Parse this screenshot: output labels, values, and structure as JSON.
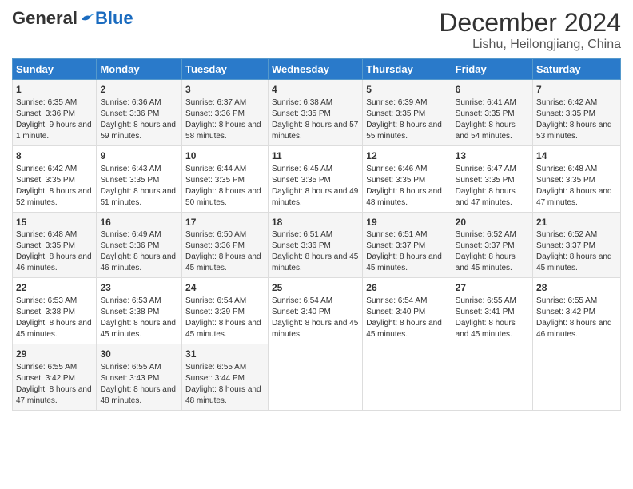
{
  "header": {
    "logo_general": "General",
    "logo_blue": "Blue",
    "month_title": "December 2024",
    "location": "Lishu, Heilongjiang, China"
  },
  "days_of_week": [
    "Sunday",
    "Monday",
    "Tuesday",
    "Wednesday",
    "Thursday",
    "Friday",
    "Saturday"
  ],
  "weeks": [
    [
      {
        "day": "1",
        "sunrise": "Sunrise: 6:35 AM",
        "sunset": "Sunset: 3:36 PM",
        "daylight": "Daylight: 9 hours and 1 minute."
      },
      {
        "day": "2",
        "sunrise": "Sunrise: 6:36 AM",
        "sunset": "Sunset: 3:36 PM",
        "daylight": "Daylight: 8 hours and 59 minutes."
      },
      {
        "day": "3",
        "sunrise": "Sunrise: 6:37 AM",
        "sunset": "Sunset: 3:36 PM",
        "daylight": "Daylight: 8 hours and 58 minutes."
      },
      {
        "day": "4",
        "sunrise": "Sunrise: 6:38 AM",
        "sunset": "Sunset: 3:35 PM",
        "daylight": "Daylight: 8 hours and 57 minutes."
      },
      {
        "day": "5",
        "sunrise": "Sunrise: 6:39 AM",
        "sunset": "Sunset: 3:35 PM",
        "daylight": "Daylight: 8 hours and 55 minutes."
      },
      {
        "day": "6",
        "sunrise": "Sunrise: 6:41 AM",
        "sunset": "Sunset: 3:35 PM",
        "daylight": "Daylight: 8 hours and 54 minutes."
      },
      {
        "day": "7",
        "sunrise": "Sunrise: 6:42 AM",
        "sunset": "Sunset: 3:35 PM",
        "daylight": "Daylight: 8 hours and 53 minutes."
      }
    ],
    [
      {
        "day": "8",
        "sunrise": "Sunrise: 6:42 AM",
        "sunset": "Sunset: 3:35 PM",
        "daylight": "Daylight: 8 hours and 52 minutes."
      },
      {
        "day": "9",
        "sunrise": "Sunrise: 6:43 AM",
        "sunset": "Sunset: 3:35 PM",
        "daylight": "Daylight: 8 hours and 51 minutes."
      },
      {
        "day": "10",
        "sunrise": "Sunrise: 6:44 AM",
        "sunset": "Sunset: 3:35 PM",
        "daylight": "Daylight: 8 hours and 50 minutes."
      },
      {
        "day": "11",
        "sunrise": "Sunrise: 6:45 AM",
        "sunset": "Sunset: 3:35 PM",
        "daylight": "Daylight: 8 hours and 49 minutes."
      },
      {
        "day": "12",
        "sunrise": "Sunrise: 6:46 AM",
        "sunset": "Sunset: 3:35 PM",
        "daylight": "Daylight: 8 hours and 48 minutes."
      },
      {
        "day": "13",
        "sunrise": "Sunrise: 6:47 AM",
        "sunset": "Sunset: 3:35 PM",
        "daylight": "Daylight: 8 hours and 47 minutes."
      },
      {
        "day": "14",
        "sunrise": "Sunrise: 6:48 AM",
        "sunset": "Sunset: 3:35 PM",
        "daylight": "Daylight: 8 hours and 47 minutes."
      }
    ],
    [
      {
        "day": "15",
        "sunrise": "Sunrise: 6:48 AM",
        "sunset": "Sunset: 3:35 PM",
        "daylight": "Daylight: 8 hours and 46 minutes."
      },
      {
        "day": "16",
        "sunrise": "Sunrise: 6:49 AM",
        "sunset": "Sunset: 3:36 PM",
        "daylight": "Daylight: 8 hours and 46 minutes."
      },
      {
        "day": "17",
        "sunrise": "Sunrise: 6:50 AM",
        "sunset": "Sunset: 3:36 PM",
        "daylight": "Daylight: 8 hours and 45 minutes."
      },
      {
        "day": "18",
        "sunrise": "Sunrise: 6:51 AM",
        "sunset": "Sunset: 3:36 PM",
        "daylight": "Daylight: 8 hours and 45 minutes."
      },
      {
        "day": "19",
        "sunrise": "Sunrise: 6:51 AM",
        "sunset": "Sunset: 3:37 PM",
        "daylight": "Daylight: 8 hours and 45 minutes."
      },
      {
        "day": "20",
        "sunrise": "Sunrise: 6:52 AM",
        "sunset": "Sunset: 3:37 PM",
        "daylight": "Daylight: 8 hours and 45 minutes."
      },
      {
        "day": "21",
        "sunrise": "Sunrise: 6:52 AM",
        "sunset": "Sunset: 3:37 PM",
        "daylight": "Daylight: 8 hours and 45 minutes."
      }
    ],
    [
      {
        "day": "22",
        "sunrise": "Sunrise: 6:53 AM",
        "sunset": "Sunset: 3:38 PM",
        "daylight": "Daylight: 8 hours and 45 minutes."
      },
      {
        "day": "23",
        "sunrise": "Sunrise: 6:53 AM",
        "sunset": "Sunset: 3:38 PM",
        "daylight": "Daylight: 8 hours and 45 minutes."
      },
      {
        "day": "24",
        "sunrise": "Sunrise: 6:54 AM",
        "sunset": "Sunset: 3:39 PM",
        "daylight": "Daylight: 8 hours and 45 minutes."
      },
      {
        "day": "25",
        "sunrise": "Sunrise: 6:54 AM",
        "sunset": "Sunset: 3:40 PM",
        "daylight": "Daylight: 8 hours and 45 minutes."
      },
      {
        "day": "26",
        "sunrise": "Sunrise: 6:54 AM",
        "sunset": "Sunset: 3:40 PM",
        "daylight": "Daylight: 8 hours and 45 minutes."
      },
      {
        "day": "27",
        "sunrise": "Sunrise: 6:55 AM",
        "sunset": "Sunset: 3:41 PM",
        "daylight": "Daylight: 8 hours and 45 minutes."
      },
      {
        "day": "28",
        "sunrise": "Sunrise: 6:55 AM",
        "sunset": "Sunset: 3:42 PM",
        "daylight": "Daylight: 8 hours and 46 minutes."
      }
    ],
    [
      {
        "day": "29",
        "sunrise": "Sunrise: 6:55 AM",
        "sunset": "Sunset: 3:42 PM",
        "daylight": "Daylight: 8 hours and 47 minutes."
      },
      {
        "day": "30",
        "sunrise": "Sunrise: 6:55 AM",
        "sunset": "Sunset: 3:43 PM",
        "daylight": "Daylight: 8 hours and 48 minutes."
      },
      {
        "day": "31",
        "sunrise": "Sunrise: 6:55 AM",
        "sunset": "Sunset: 3:44 PM",
        "daylight": "Daylight: 8 hours and 48 minutes."
      },
      null,
      null,
      null,
      null
    ]
  ]
}
